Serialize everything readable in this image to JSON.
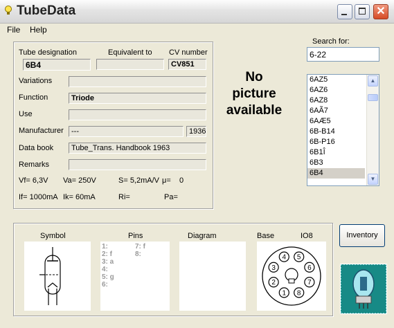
{
  "window": {
    "title": "TubeData"
  },
  "menu": {
    "file": "File",
    "help": "Help"
  },
  "details": {
    "tube_designation_label": "Tube designation",
    "tube_designation": "6B4",
    "equivalent_label": "Equivalent to",
    "equivalent": "",
    "cv_label": "CV number",
    "cv": "CV851",
    "variations_label": "Variations",
    "variations": "",
    "function_label": "Function",
    "function": "Triode",
    "use_label": "Use",
    "use": "",
    "manufacturer_label": "Manufacturer",
    "manufacturer": "---",
    "year": "1936",
    "databook_label": "Data book",
    "databook": "Tube_Trans. Handbook 1963",
    "remarks_label": "Remarks",
    "remarks": ""
  },
  "params": {
    "vf": "Vf= 6,3V",
    "va": "Va= 250V",
    "s": "S= 5,2mA/V",
    "mu": "μ=",
    "mu_value": "0",
    "if": "If= 1000mA",
    "ik": "Ik= 60mA",
    "ri": "Ri=",
    "pa": "Pa="
  },
  "picture": {
    "line1": "No",
    "line2": "picture",
    "line3": "available"
  },
  "search": {
    "label": "Search for:",
    "value": "6-22"
  },
  "tube_list": {
    "items": [
      "6AZ5",
      "6AZ6",
      "6AZ8",
      "6AÃ7",
      "6AÆ5",
      "6B-B14",
      "6B-P16",
      "6B1Î",
      "6B3",
      "6B4"
    ],
    "selected": "6B4"
  },
  "lower": {
    "symbol_label": "Symbol",
    "pins_label": "Pins",
    "diagram_label": "Diagram",
    "base_label": "Base",
    "base_type": "IO8",
    "pins_left": [
      "1:",
      "2: f",
      "3: a",
      "4:",
      "5: g",
      "6:"
    ],
    "pins_right": [
      "7: f",
      "8:"
    ],
    "base_pins": [
      "1",
      "2",
      "3",
      "4",
      "5",
      "6",
      "7",
      "8"
    ]
  },
  "buttons": {
    "inventory": "Inventory"
  }
}
